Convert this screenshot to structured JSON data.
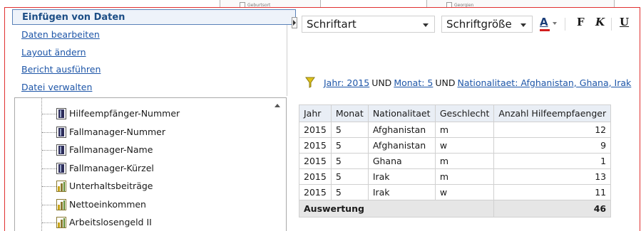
{
  "background_window": {
    "label_left": "Geburtsort",
    "label_right": "Georgien"
  },
  "nav": {
    "header": "Einfügen von Daten",
    "links": [
      "Daten bearbeiten",
      "Layout ändern",
      "Bericht ausführen",
      "Datei verwalten"
    ]
  },
  "tree": {
    "items": [
      {
        "label": "Hilfeempfänger-Nummer",
        "icon": "dimension-icon"
      },
      {
        "label": "Fallmanager-Nummer",
        "icon": "dimension-icon"
      },
      {
        "label": "Fallmanager-Name",
        "icon": "dimension-icon"
      },
      {
        "label": "Fallmanager-Kürzel",
        "icon": "dimension-icon"
      },
      {
        "label": "Unterhaltsbeiträge",
        "icon": "measure-icon"
      },
      {
        "label": "Nettoeinkommen",
        "icon": "measure-icon"
      },
      {
        "label": "Arbeitslosengeld II",
        "icon": "measure-icon"
      }
    ]
  },
  "toolbar": {
    "font_dropdown": "Schriftart",
    "size_dropdown": "Schriftgröße",
    "font_color_label": "A",
    "bold_label": "F",
    "italic_label": "K",
    "underline_label": "U",
    "font_color_accent": "#d21f1f"
  },
  "filter": {
    "jahr": "Jahr: 2015",
    "und1": "UND",
    "monat": "Monat: 5",
    "und2": "UND",
    "nationalitaet": "Nationalitaet: Afghanistan, Ghana, Irak"
  },
  "table": {
    "headers": [
      "Jahr",
      "Monat",
      "Nationalitaet",
      "Geschlecht",
      "Anzahl Hilfeempfaenger"
    ],
    "rows": [
      [
        "2015",
        "5",
        "Afghanistan",
        "m",
        "12"
      ],
      [
        "2015",
        "5",
        "Afghanistan",
        "w",
        "9"
      ],
      [
        "2015",
        "5",
        "Ghana",
        "m",
        "1"
      ],
      [
        "2015",
        "5",
        "Irak",
        "m",
        "13"
      ],
      [
        "2015",
        "5",
        "Irak",
        "w",
        "11"
      ]
    ],
    "total_label": "Auswertung",
    "total_value": "46"
  }
}
